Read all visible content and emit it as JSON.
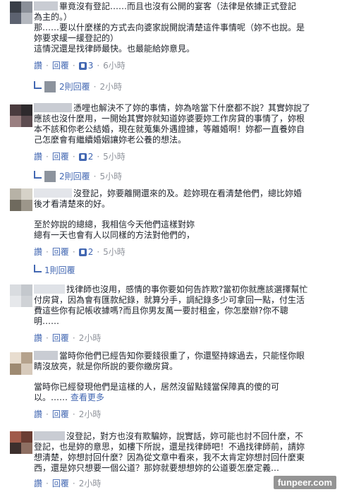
{
  "colors": {
    "link": "#4267b2",
    "meta": "#90949c",
    "text": "#1d2129",
    "name_blur": "#c9ccd3"
  },
  "comments": [
    {
      "lines": [
        "畢竟沒有登記……而且也沒有公開的宴客（法律是依據正式登記",
        "為主的。）",
        "那……要以什麼樣的方式去向婆家說開說清楚這件事情呢（妳不也說。是",
        "妳要求緩一緩登記的）",
        "這情況還是找律師最快。也最能給妳意見。"
      ],
      "like": "讚",
      "reply": "回覆",
      "like_count": "3",
      "time": "6小時",
      "replies_count_label": "2則回覆",
      "replies_time": "2小時"
    },
    {
      "lines": [
        "憑哩也解決不了妳的事情，妳為啥當下什麼都不說？其實妳說了",
        "應該也沒什麼用，一開始其實妳就知道妳婆要妳工作房貸的事情了，妳根",
        "本不該和你老公結婚，現在就蒐集外遇證據，等離婚啊！妳都一直養妳自",
        "己怎麼會有繼續婚姻讓妳老公養的想法。"
      ],
      "like": "讚",
      "reply": "回覆",
      "like_count": "2",
      "time": "5小時",
      "replies_count_label": "2則回覆",
      "replies_time": "5小時"
    },
    {
      "lines": [
        "沒登記，妳要離開還來的及。趁妳現在看清楚他們，總比妳婚",
        "後才看清楚來的好。"
      ],
      "lines2": [
        "至於妳說的總總，我相信今天他們這樣對妳",
        "總有一天也會有人以同樣的方法對他們的，"
      ],
      "like": "讚",
      "reply": "回覆",
      "like_count": "2",
      "time": "5小時",
      "replies_count_label": "1則回覆"
    },
    {
      "lines": [
        "找律師也沒用，感情的事你要如何告詐欺?當初你就應該選擇幫忙",
        "付房貸，因為會有匯款紀錄，就算分手，調紀錄多少可拿回一點，付生活",
        "費這些你有記帳收據嗎?而且你男友萬一要討租金，你怎麼辦?你不聰",
        "明……"
      ],
      "like": "讚",
      "reply": "回覆",
      "time": "2小時"
    },
    {
      "lines": [
        "當時你他們已經告知你要錢很重了，你還堅持嫁過去，只能怪你眼",
        "睛沒放亮，就是你所說的要你繳房貸。"
      ],
      "lines2": [
        "當時你已經發現他們是這樣的人，居然沒留點錢當保障真的傻的可",
        "以。"
      ],
      "see_more_prefix": "……",
      "see_more": "查看更多",
      "like": "讚",
      "reply": "回覆",
      "time": "2小時"
    },
    {
      "lines": [
        "沒登記，對方也沒有欺騙妳，說實話，妳可能也討不回什麼，不",
        "登記，也是妳的意思，如樓下所說，還是找律師吧！不過找律師前，請妳",
        "想清楚，妳想討回什麼？因為從文章中看來，我不太肯定妳想討回什麼東",
        "西，還是妳只想要一個公道？那妳就要想想妳的公道要怎麼定義…"
      ],
      "like": "讚",
      "reply": "回覆",
      "time": "2小時"
    }
  ],
  "watermark": "funpeer.com"
}
